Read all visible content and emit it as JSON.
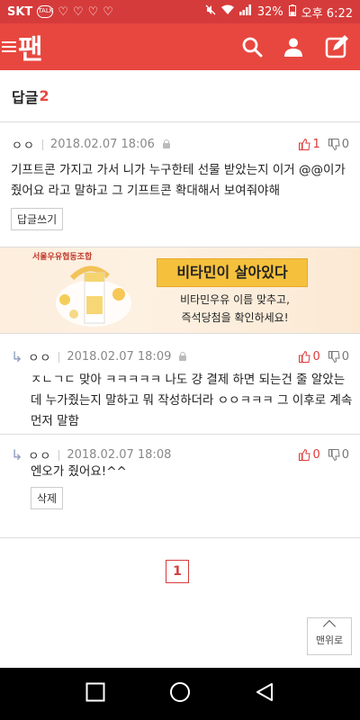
{
  "status_bar": {
    "carrier": "SKT",
    "battery": "32%",
    "time": "오후 6:22"
  },
  "app_bar": {
    "logo_text": "팬"
  },
  "section": {
    "label": "답글",
    "count": "2"
  },
  "comments": [
    {
      "name": "ㅇㅇ",
      "date": "2018.02.07 18:06",
      "up": "1",
      "down": "0",
      "text": "기프트콘 가지고 가서 니가 누구한테 선물 받았는지 이거 @@이가 줬어요 라고 말하고 그 기프트콘 확대해서 보여줘야해",
      "button": "답글쓰기"
    },
    {
      "name": "ㅇㅇ",
      "date": "2018.02.07 18:09",
      "up": "0",
      "down": "0",
      "text": "ㅈㄴㄱㄷ 맞아 ㅋㅋㅋㅋㅋ 나도 걍 결제 하면 되는건 줄 알았는데 누가줬는지 말하고 뭐 작성하더라 ㅇㅇㅋㅋㅋ 그 이후로 계속 먼저 말함"
    },
    {
      "name": "ㅇㅇ",
      "date": "2018.02.07 18:08",
      "up": "0",
      "down": "0",
      "text": "엔오가 줬어요!^^",
      "button": "삭제"
    }
  ],
  "ad": {
    "brand": "서울우유협동조합",
    "title": "비타민이 살아있다",
    "line1": "비타민우유 이름 맞추고,",
    "line2": "즉석당첨을 확인하세요!"
  },
  "pager": {
    "current": "1"
  },
  "top_button": {
    "label": "맨위로"
  },
  "colors": {
    "brand": "#e8473f",
    "accent_red": "#e03a3a"
  }
}
